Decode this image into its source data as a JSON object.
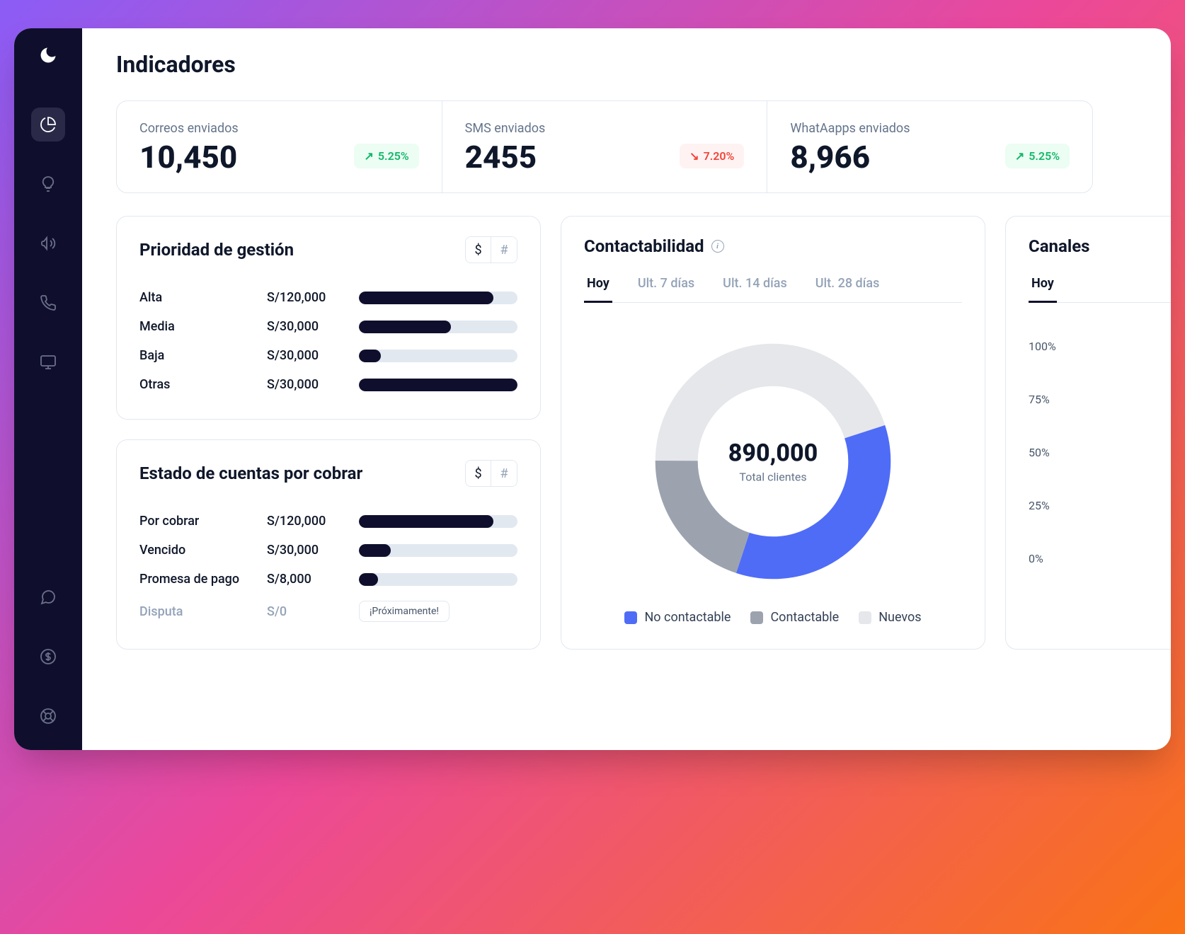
{
  "page": {
    "title": "Indicadores"
  },
  "kpis": [
    {
      "label": "Correos enviados",
      "value": "10,450",
      "delta": "5.25%",
      "direction": "up"
    },
    {
      "label": "SMS enviados",
      "value": "2455",
      "delta": "7.20%",
      "direction": "down"
    },
    {
      "label": "WhatAapps enviados",
      "value": "8,966",
      "delta": "5.25%",
      "direction": "up"
    }
  ],
  "priority": {
    "title": "Prioridad de gestión",
    "toggles": {
      "currency": "$",
      "count": "#"
    },
    "rows": [
      {
        "label": "Alta",
        "value": "S/120,000",
        "pct": 85
      },
      {
        "label": "Media",
        "value": "S/30,000",
        "pct": 58
      },
      {
        "label": "Baja",
        "value": "S/30,000",
        "pct": 14
      },
      {
        "label": "Otras",
        "value": "S/30,000",
        "pct": 100
      }
    ]
  },
  "accounts": {
    "title": "Estado de cuentas por cobrar",
    "toggles": {
      "currency": "$",
      "count": "#"
    },
    "rows": [
      {
        "label": "Por cobrar",
        "value": "S/120,000",
        "pct": 85
      },
      {
        "label": "Vencido",
        "value": "S/30,000",
        "pct": 20
      },
      {
        "label": "Promesa de pago",
        "value": "S/8,000",
        "pct": 12
      },
      {
        "label": "Disputa",
        "value": "S/0",
        "soon": "¡Próximamente!"
      }
    ]
  },
  "contactability": {
    "title": "Contactabilidad",
    "tabs": [
      "Hoy",
      "Ult. 7 días",
      "Ult. 14 días",
      "Ult. 28 días"
    ],
    "active_tab": "Hoy",
    "total_value": "890,000",
    "total_label": "Total clientes",
    "legend": [
      {
        "label": "No contactable",
        "color": "#4f6cf7"
      },
      {
        "label": "Contactable",
        "color": "#9ca3af"
      },
      {
        "label": "Nuevos",
        "color": "#e5e7eb"
      }
    ]
  },
  "channels": {
    "title": "Canales",
    "tabs": [
      "Hoy"
    ],
    "y_axis": [
      "100%",
      "75%",
      "50%",
      "25%",
      "0%"
    ]
  },
  "chart_data": [
    {
      "type": "bar",
      "title": "Prioridad de gestión",
      "categories": [
        "Alta",
        "Media",
        "Baja",
        "Otras"
      ],
      "values": [
        120000,
        30000,
        30000,
        30000
      ],
      "currency": "S/",
      "bar_fill_pct": [
        85,
        58,
        14,
        100
      ]
    },
    {
      "type": "bar",
      "title": "Estado de cuentas por cobrar",
      "categories": [
        "Por cobrar",
        "Vencido",
        "Promesa de pago",
        "Disputa"
      ],
      "values": [
        120000,
        30000,
        8000,
        0
      ],
      "currency": "S/",
      "bar_fill_pct": [
        85,
        20,
        12,
        0
      ]
    },
    {
      "type": "pie",
      "title": "Contactabilidad",
      "series": [
        {
          "name": "No contactable",
          "value": 35,
          "color": "#4f6cf7"
        },
        {
          "name": "Contactable",
          "value": 20,
          "color": "#9ca3af"
        },
        {
          "name": "Nuevos",
          "value": 45,
          "color": "#e5e7eb"
        }
      ],
      "total_label": "Total clientes",
      "total_value": 890000
    },
    {
      "type": "bar",
      "title": "Canales",
      "ylabel": "%",
      "ylim": [
        0,
        100
      ],
      "y_ticks": [
        0,
        25,
        50,
        75,
        100
      ]
    }
  ]
}
